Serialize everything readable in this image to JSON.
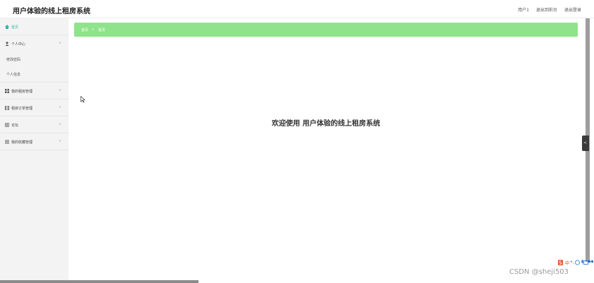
{
  "header": {
    "app_title": "用户体验的线上租房系统",
    "user": "用户1",
    "back_to_front": "退出到前台",
    "logout": "退出登录"
  },
  "sidebar": {
    "items": [
      {
        "label": "首页",
        "icon": "home-icon"
      },
      {
        "label": "个人中心",
        "icon": "user-icon",
        "chevron": "∨"
      },
      {
        "label": "我的租房管理",
        "icon": "grid-icon",
        "chevron": "∨"
      },
      {
        "label": "租房订单管理",
        "icon": "document-icon",
        "chevron": "∨"
      },
      {
        "label": "论坛",
        "icon": "forum-icon",
        "chevron": "∨"
      },
      {
        "label": "我的收藏管理",
        "icon": "list-icon",
        "chevron": "∨"
      }
    ],
    "sub_items": [
      {
        "label": "修改密码"
      },
      {
        "label": "个人信息"
      }
    ]
  },
  "breadcrumb": {
    "first": "首页",
    "arrow": "→",
    "second": "首页"
  },
  "main": {
    "welcome": "欢迎使用 用户体验的线上租房系统"
  },
  "side_tab": {
    "glyph": "<"
  },
  "watermark": "CSDN @sheji503",
  "colors": {
    "accent": "#2fb8a5",
    "breadcrumb_bg": "#8fe38a",
    "sidebar_bg": "#f3f3f4"
  }
}
